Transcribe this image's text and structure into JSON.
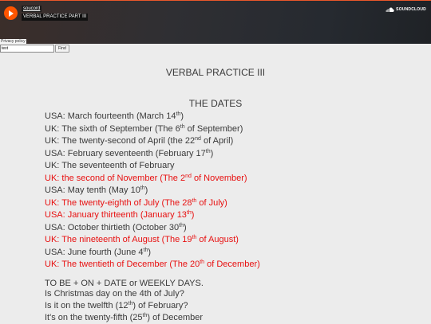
{
  "player": {
    "artist": "soucord",
    "track_title": "VERBAL PRACTICE PART III",
    "brand": "SOUNDCLOUD",
    "privacy": "Privacy policy",
    "brand_color": "#ff5500"
  },
  "find": {
    "value": "text",
    "button": "Find"
  },
  "content": {
    "title": "VERBAL PRACTICE III",
    "section_title": "THE DATES",
    "dates": [
      {
        "pre": "USA: March fourteenth (March 14",
        "sup": "th",
        "post": ")",
        "color": "normal"
      },
      {
        "pre": "UK: The sixth of September (The 6",
        "sup": "th",
        "post": " of September)",
        "color": "normal"
      },
      {
        "pre": "UK: The twenty-second of April (the 22",
        "sup": "nd",
        "post": " of April)",
        "color": "normal"
      },
      {
        "pre": "USA: February seventeenth (February 17",
        "sup": "th",
        "post": ")",
        "color": "normal"
      },
      {
        "pre": "UK: The seventeenth of February",
        "sup": "",
        "post": "",
        "color": "normal"
      },
      {
        "pre": "UK: the second of November (The 2",
        "sup": "nd",
        "post": " of November)",
        "color": "red"
      },
      {
        "pre": "USA: May tenth (May 10",
        "sup": "th",
        "post": ")",
        "color": "normal"
      },
      {
        "pre": "UK: The twenty-eighth of July (The 28",
        "sup": "th",
        "post": " of July)",
        "color": "red"
      },
      {
        "pre": "USA: January thirteenth (January 13",
        "sup": "th",
        "post": ")",
        "color": "red"
      },
      {
        "pre": "USA: October thirtieth (October 30",
        "sup": "th",
        "post": ")",
        "color": "normal"
      },
      {
        "pre": "UK: The nineteenth of August (The 19",
        "sup": "th",
        "post": " of August)",
        "color": "red"
      },
      {
        "pre": "USA: June fourth (June 4",
        "sup": "th",
        "post": ")",
        "color": "normal"
      },
      {
        "pre": "UK: The twentieth of December (The 20",
        "sup": "th",
        "post": " of December)",
        "color": "red"
      }
    ],
    "grammar_heading": "TO BE + ON + DATE or WEEKLY DAYS.",
    "examples": [
      {
        "pre": "Is Christmas day on the 4th of July?",
        "sup": "",
        "post": ""
      },
      {
        "pre": "Is it on the twelfth (12",
        "sup": "th",
        "post": ") of February?"
      },
      {
        "pre": "It's on the twenty-fifth (25",
        "sup": "th",
        "post": ") of December"
      }
    ],
    "colors": {
      "text": "#3a3a3a",
      "highlight": "#e81010"
    }
  }
}
